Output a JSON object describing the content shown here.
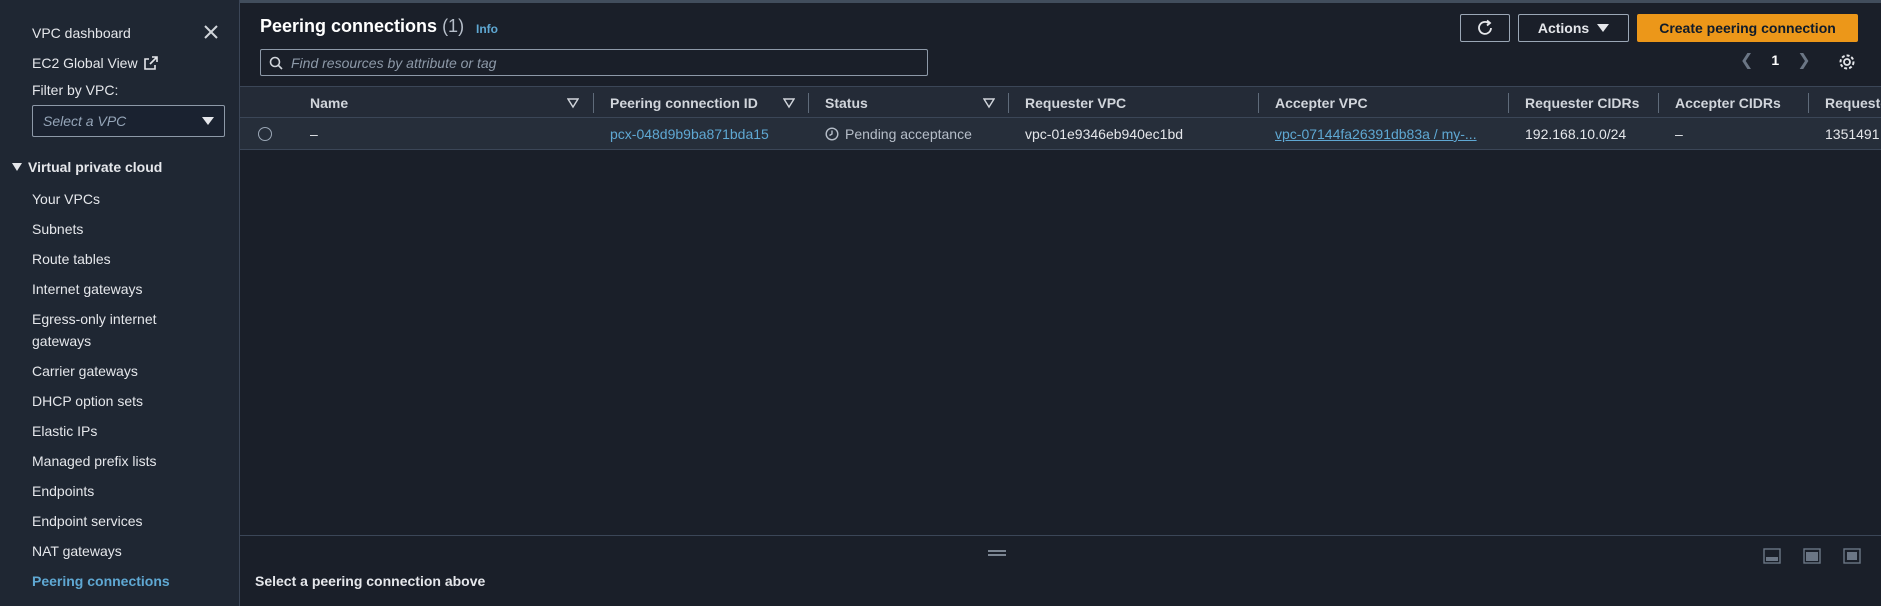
{
  "sidebar": {
    "dashboard": "VPC dashboard",
    "global_view": "EC2 Global View",
    "filter_label": "Filter by VPC:",
    "filter_placeholder": "Select a VPC",
    "section_title": "Virtual private cloud",
    "items": [
      {
        "label": "Your VPCs"
      },
      {
        "label": "Subnets"
      },
      {
        "label": "Route tables"
      },
      {
        "label": "Internet gateways"
      },
      {
        "label": "Egress-only internet gateways"
      },
      {
        "label": "Carrier gateways"
      },
      {
        "label": "DHCP option sets"
      },
      {
        "label": "Elastic IPs"
      },
      {
        "label": "Managed prefix lists"
      },
      {
        "label": "Endpoints"
      },
      {
        "label": "Endpoint services"
      },
      {
        "label": "NAT gateways"
      },
      {
        "label": "Peering connections"
      }
    ]
  },
  "header": {
    "title": "Peering connections",
    "count": "(1)",
    "info": "Info",
    "actions_label": "Actions",
    "create_label": "Create peering connection"
  },
  "search": {
    "placeholder": "Find resources by attribute or tag"
  },
  "pagination": {
    "page": "1"
  },
  "table": {
    "columns": [
      "Name",
      "Peering connection ID",
      "Status",
      "Requester VPC",
      "Accepter VPC",
      "Requester CIDRs",
      "Accepter CIDRs",
      "Requeste"
    ],
    "rows": [
      {
        "name": "–",
        "peering_id": "pcx-048d9b9ba871bda15",
        "status": "Pending acceptance",
        "requester_vpc": "vpc-01e9346eb940ec1bd",
        "accepter_vpc": "vpc-07144fa26391db83a / my-...",
        "requester_cidrs": "192.168.10.0/24",
        "accepter_cidrs": "–",
        "requester_owner": "1351491"
      }
    ]
  },
  "details_panel": {
    "message": "Select a peering connection above"
  },
  "colors": {
    "accent": "#5fa8d3",
    "primary_button": "#ec9719",
    "background": "#1a1f29",
    "sidebar": "#1f2733"
  }
}
